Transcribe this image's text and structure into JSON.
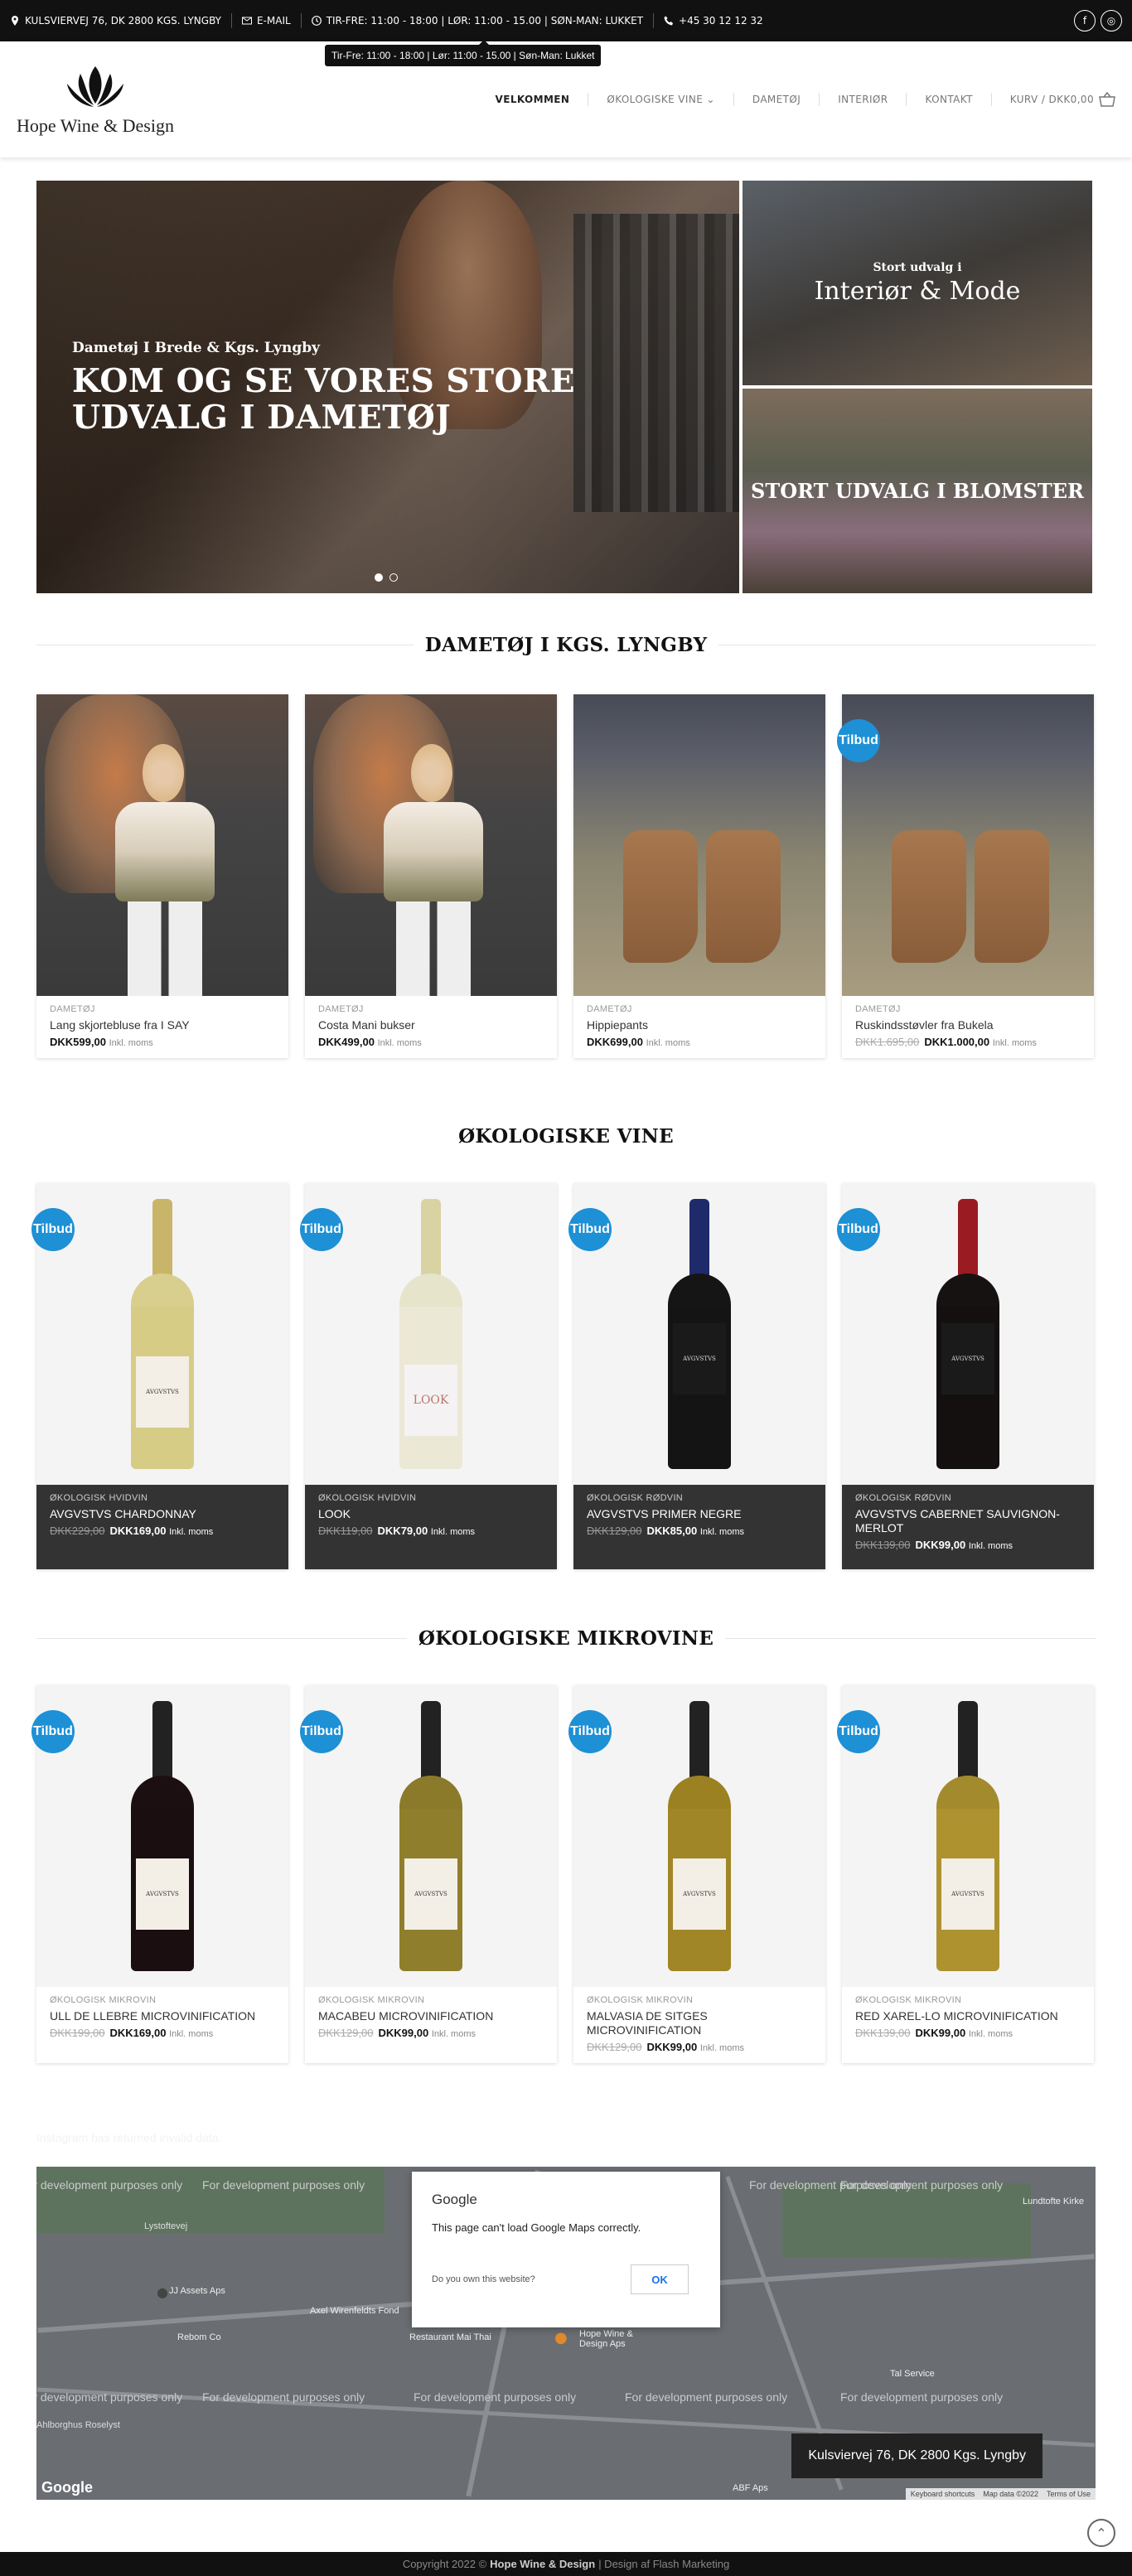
{
  "topbar": {
    "address": "KULSVIERVEJ 76, DK 2800 KGS. LYNGBY",
    "email": "E-MAIL",
    "hours": "TIR-FRE: 11:00 - 18:00 | LØR: 11:00 - 15.00 | SØN-MAN: LUKKET",
    "phone": "+45 30 12 12 32",
    "tooltip": "Tir-Fre: 11:00 - 18:00 | Lør: 11:00 - 15.00 | Søn-Man: Lukket"
  },
  "header": {
    "logo_text": "Hope Wine & Design",
    "nav": [
      "VELKOMMEN",
      "ØKOLOGISKE VINE",
      "DAMETØJ",
      "INTERIØR",
      "KONTAKT"
    ],
    "cart": "KURV / DKK0,00"
  },
  "hero": {
    "kicker": "Dametøj I Brede & Kgs. Lyngby",
    "title": "KOM OG SE VORES STORE UDVALG I DAMETØJ",
    "side_a_small": "Stort udvalg i",
    "side_a_big": "Interiør & Mode",
    "side_b": "STORT UDVALG I BLOMSTER"
  },
  "sections": {
    "dametoj": "DAMETØJ I KGS. LYNGBY",
    "vine": "ØKOLOGISKE VINE",
    "mikrovine": "ØKOLOGISKE MIKROVINE"
  },
  "badge": "Tilbud",
  "incl": "Inkl. moms",
  "dametoj_products": [
    {
      "cat": "DAMETØJ",
      "name": "Lang skjortebluse fra I SAY",
      "old": "",
      "price": "DKK599,00"
    },
    {
      "cat": "DAMETØJ",
      "name": "Costa Mani bukser",
      "old": "",
      "price": "DKK499,00"
    },
    {
      "cat": "DAMETØJ",
      "name": "Hippiepants",
      "old": "",
      "price": "DKK699,00"
    },
    {
      "cat": "DAMETØJ",
      "name": "Ruskindsstøvler fra Bukela",
      "old": "DKK1.695,00",
      "price": "DKK1.000,00"
    }
  ],
  "vine_products": [
    {
      "cat": "ØKOLOGISK HVIDVIN",
      "name": "AVGVSTVS CHARDONNAY",
      "old": "DKK229,00",
      "price": "DKK169,00"
    },
    {
      "cat": "ØKOLOGISK HVIDVIN",
      "name": "LOOK",
      "old": "DKK119,00",
      "price": "DKK79,00"
    },
    {
      "cat": "ØKOLOGISK RØDVIN",
      "name": "AVGVSTVS PRIMER NEGRE",
      "old": "DKK129,00",
      "price": "DKK85,00"
    },
    {
      "cat": "ØKOLOGISK RØDVIN",
      "name": "AVGVSTVS CABERNET SAUVIGNON-MERLOT",
      "old": "DKK139,00",
      "price": "DKK99,00"
    }
  ],
  "mikro_products": [
    {
      "cat": "ØKOLOGISK MIKROVIN",
      "name": "ULL DE LLEBRE MICROVINIFICATION",
      "old": "DKK199,00",
      "price": "DKK169,00"
    },
    {
      "cat": "ØKOLOGISK MIKROVIN",
      "name": "MACABEU MICROVINIFICATION",
      "old": "DKK129,00",
      "price": "DKK99,00"
    },
    {
      "cat": "ØKOLOGISK MIKROVIN",
      "name": "MALVASIA DE SITGES MICROVINIFICATION",
      "old": "DKK129,00",
      "price": "DKK99,00"
    },
    {
      "cat": "ØKOLOGISK MIKROVIN",
      "name": "RED XAREL-LO MICROVINIFICATION",
      "old": "DKK139,00",
      "price": "DKK99,00"
    }
  ],
  "instagram_error": "Instagram has returned invalid data.",
  "map": {
    "dev_text": "For development purposes only",
    "dialog_title": "Google",
    "dialog_msg": "This page can't load Google Maps correctly.",
    "dialog_q": "Do you own this website?",
    "dialog_ok": "OK",
    "address": "Kulsviervej 76, DK 2800 Kgs. Lyngby",
    "google": "Google",
    "keyboard": "Keyboard shortcuts",
    "mapdata": "Map data ©2022",
    "terms": "Terms of Use",
    "places": [
      "JJ Assets Aps",
      "Axel Wirenfeldts Fond",
      "Rebom Co",
      "Restaurant Mai Thai",
      "Hope Wine & Design Aps",
      "Tal Service",
      "Lundtofte Kirke",
      "Lystoftevej",
      "ABF Aps",
      "Ahlborghus Roselyst"
    ]
  },
  "footer": {
    "pre": "Copyright 2022 ©",
    "brand": "Hope Wine & Design",
    "post": "| Design af Flash Marketing"
  },
  "colors": {
    "badge": "#1d90d6",
    "topbar": "#111111",
    "dark_card": "#333333"
  }
}
